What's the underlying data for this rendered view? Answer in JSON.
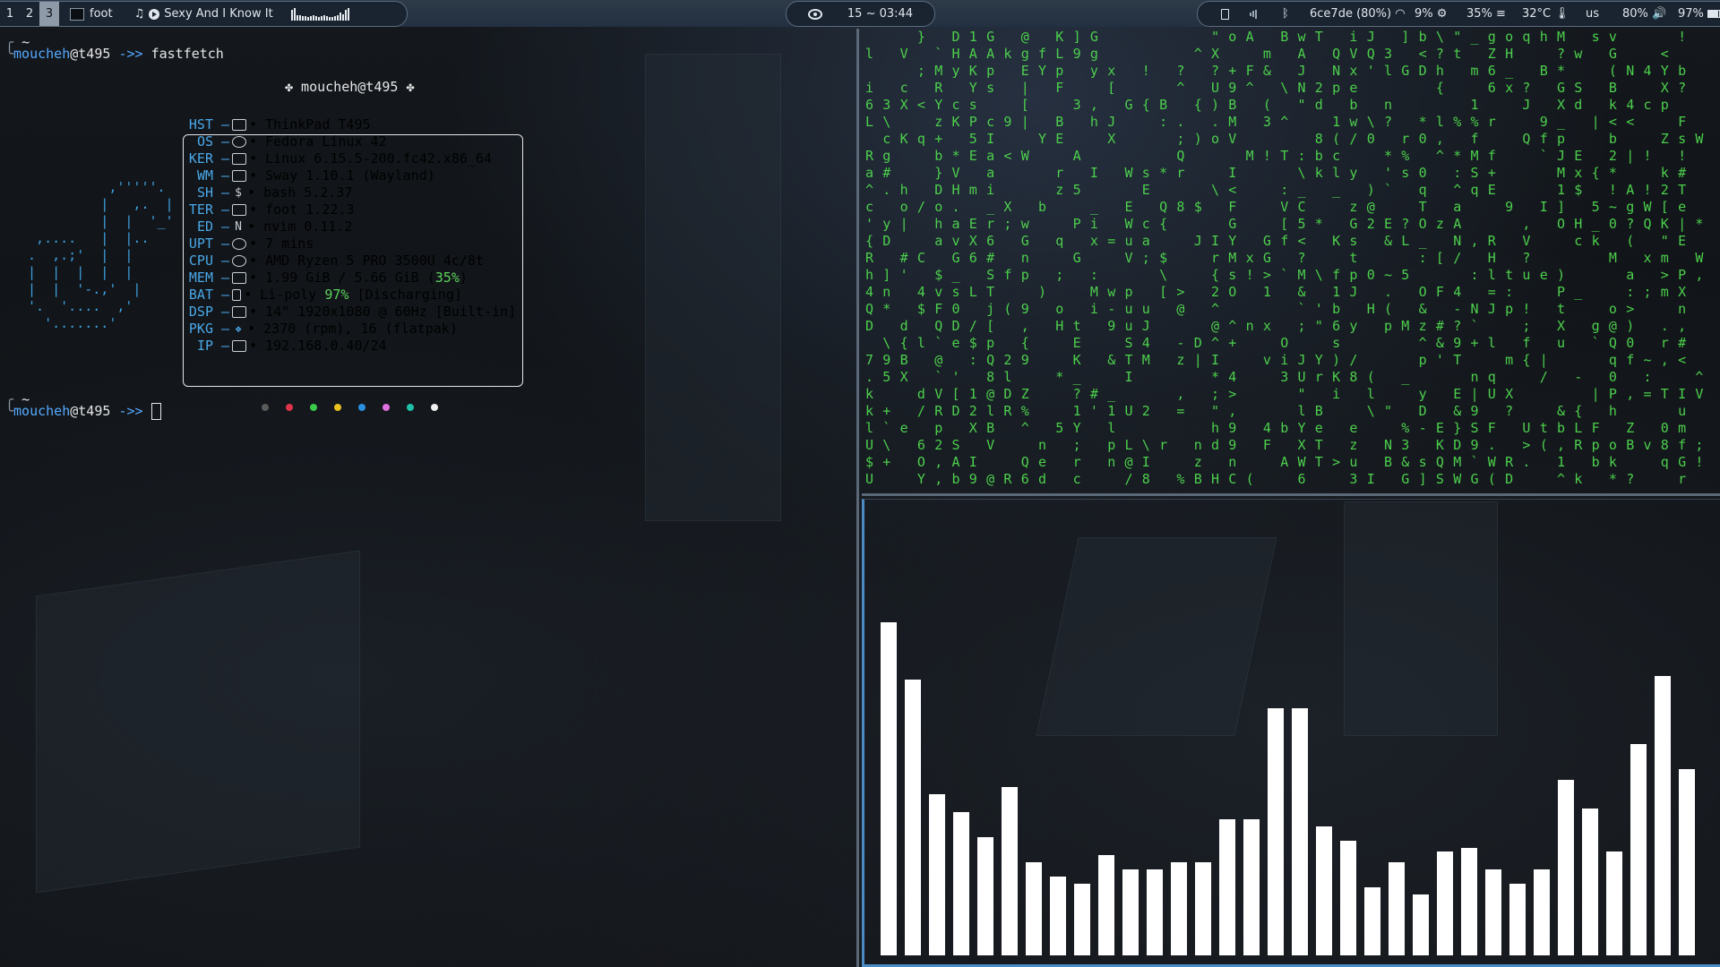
{
  "topbar": {
    "workspaces": [
      "1",
      "2",
      "3"
    ],
    "active_workspace": "3",
    "window_title": "foot",
    "media_title": "Sexy And I Know It",
    "clock": "15 ~ 03:44",
    "network": "6ce7de (80%)",
    "cpu": "9%",
    "memory": "35%",
    "temperature": "32°C",
    "keyboard_layout": "us",
    "volume": "80%",
    "battery": "97%"
  },
  "terminal": {
    "prompt_dir": "~",
    "user": "moucheh",
    "host": "@t495",
    "arrow": "->>",
    "command": "fastfetch",
    "header": "✤ moucheh@t495 ✤",
    "info": [
      {
        "key": "HST",
        "value": "ThinkPad T495"
      },
      {
        "key": "OS",
        "value": "Fedora Linux 42"
      },
      {
        "key": "KER",
        "value": "Linux 6.15.5-200.fc42.x86_64"
      },
      {
        "key": "WM",
        "value": "Sway 1.10.1 (Wayland)"
      },
      {
        "key": "SH",
        "value": "bash 5.2.37"
      },
      {
        "key": "TER",
        "value": "foot 1.22.3"
      },
      {
        "key": "ED",
        "value": "nvim 0.11.2"
      },
      {
        "key": "UPT",
        "value": "7 mins"
      },
      {
        "key": "CPU",
        "value": "AMD Ryzen 5 PRO 3500U 4c/8t"
      },
      {
        "key": "MEM",
        "value": "1.99 GiB / 5.66 GiB (",
        "extra": "35%",
        "tail": ")"
      },
      {
        "key": "BAT",
        "value": "Li-poly ",
        "extra": "97%",
        "tail": " [Discharging]"
      },
      {
        "key": "DSP",
        "value": "14\" 1920x1080 @ 60Hz [Built-in]"
      },
      {
        "key": "PKG",
        "value": "2370 (rpm), 16 (flatpak)"
      },
      {
        "key": "IP",
        "value": "192.168.0.40/24"
      }
    ],
    "palette": [
      "#5a5a5a",
      "#e0324a",
      "#3cc84a",
      "#e8c020",
      "#2a90e0",
      "#e070e0",
      "#20c0a8",
      "#f0f0f0"
    ]
  },
  "visualizer": {
    "levels": [
      0.93,
      0.77,
      0.45,
      0.4,
      0.33,
      0.47,
      0.26,
      0.22,
      0.2,
      0.28,
      0.24,
      0.24,
      0.26,
      0.26,
      0.38,
      0.38,
      0.69,
      0.69,
      0.36,
      0.32,
      0.19,
      0.26,
      0.17,
      0.29,
      0.3,
      0.24,
      0.2,
      0.24,
      0.49,
      0.41,
      0.29,
      0.59,
      0.78,
      0.52
    ]
  }
}
